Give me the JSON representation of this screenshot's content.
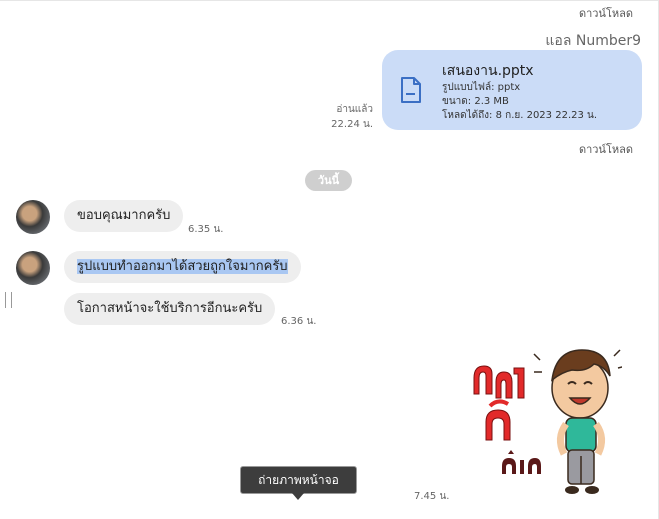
{
  "download_label_top": "ดาวน์โหลด",
  "sender_name": "แอล Number9",
  "file_message": {
    "file_name": "เสนองาน.pptx",
    "format_line": "รูปแบบไฟล์: pptx",
    "size_line": "ขนาด: 2.3 MB",
    "expiry_line": "โหลดได้ถึง: 8 ก.ย. 2023 22.23 น.",
    "read_status": "อ่านแล้ว",
    "time": "22.24 น.",
    "download_label": "ดาวน์โหลด",
    "icon": "file-icon"
  },
  "date_separator": "วันนี้",
  "incoming_messages": [
    {
      "text": "ขอบคุณมากครับ",
      "time": "6.35 น."
    },
    {
      "text": "รูปแบบทำออกมาได้สวยถูกใจมากครับ",
      "highlighted": true
    },
    {
      "text": "โอกาสหน้าจะใช้บริการอีกนะครับ",
      "time": "6.36 น."
    }
  ],
  "sticker": {
    "lettering": "ยินดีค้าบ",
    "time": "7.45 น."
  },
  "tooltip": "ถ่ายภาพหน้าจอ",
  "colors": {
    "outgoing_bubble": "#cbdcf7",
    "incoming_bubble": "#eeeeee",
    "selection": "#a9c7f2",
    "date_chip": "#cfcfcf",
    "tooltip_bg": "#3d3d3d"
  }
}
